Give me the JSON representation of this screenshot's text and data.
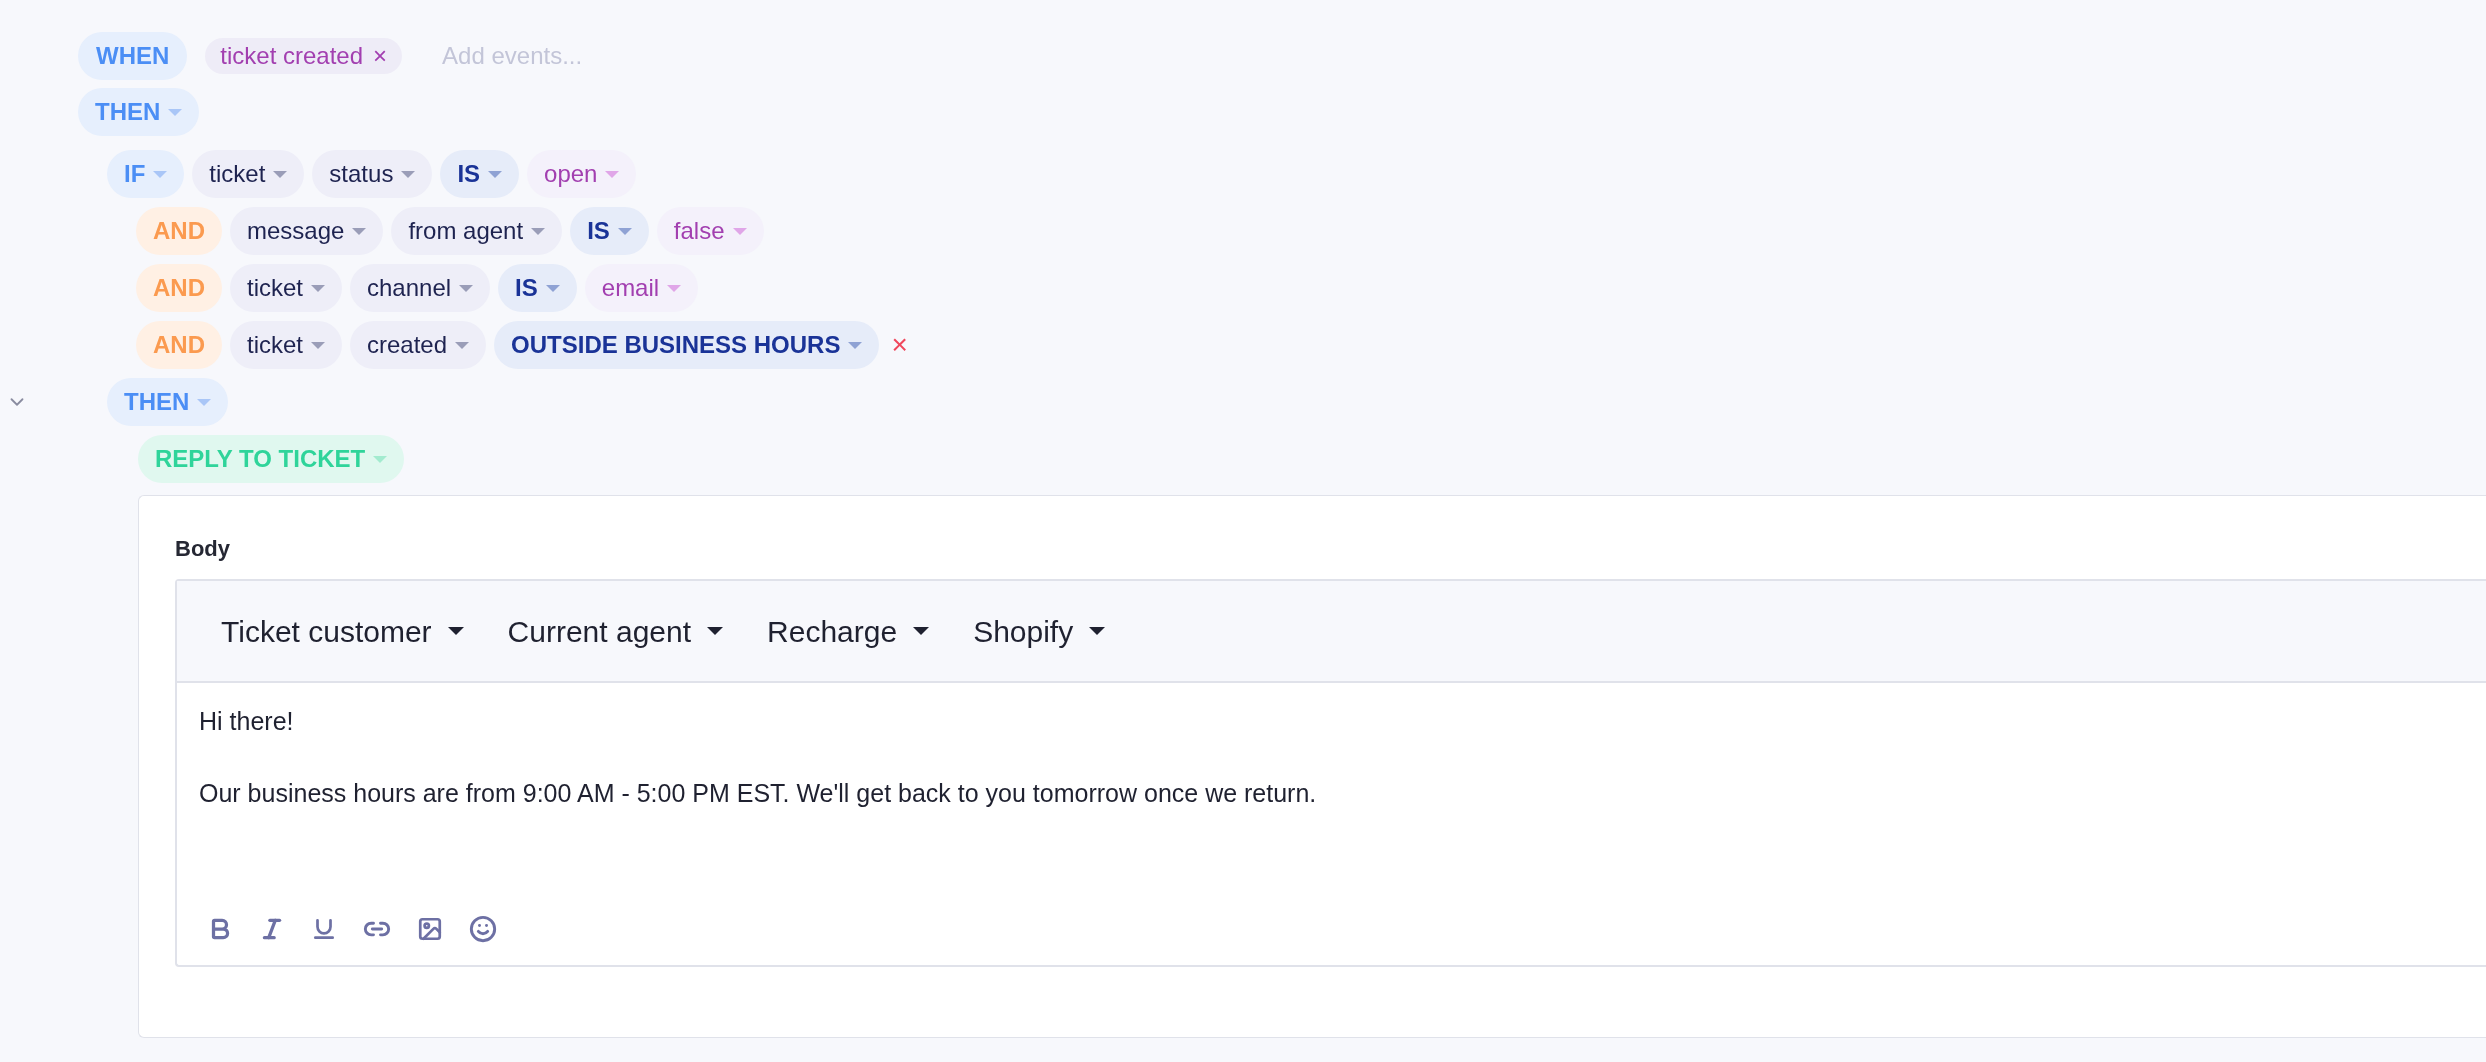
{
  "trigger": {
    "label": "WHEN",
    "events": [
      {
        "label": "ticket created",
        "remove": "×"
      }
    ],
    "placeholder": "Add events..."
  },
  "then": {
    "label": "THEN"
  },
  "conditions": [
    {
      "conjunction": {
        "text": "IF",
        "kind": "keyword"
      },
      "tokens": [
        {
          "text": "ticket",
          "kind": "field"
        },
        {
          "text": "status",
          "kind": "field"
        },
        {
          "text": "IS",
          "kind": "operator"
        },
        {
          "text": "open",
          "kind": "value"
        }
      ]
    },
    {
      "conjunction": {
        "text": "AND",
        "kind": "conjunction"
      },
      "tokens": [
        {
          "text": "message",
          "kind": "field"
        },
        {
          "text": "from agent",
          "kind": "field"
        },
        {
          "text": "IS",
          "kind": "operator"
        },
        {
          "text": "false",
          "kind": "value"
        }
      ]
    },
    {
      "conjunction": {
        "text": "AND",
        "kind": "conjunction"
      },
      "tokens": [
        {
          "text": "ticket",
          "kind": "field"
        },
        {
          "text": "channel",
          "kind": "field"
        },
        {
          "text": "IS",
          "kind": "operator"
        },
        {
          "text": "email",
          "kind": "value"
        }
      ]
    },
    {
      "conjunction": {
        "text": "AND",
        "kind": "conjunction"
      },
      "tokens": [
        {
          "text": "ticket",
          "kind": "field"
        },
        {
          "text": "created",
          "kind": "field"
        },
        {
          "text": "OUTSIDE BUSINESS HOURS",
          "kind": "operator"
        }
      ],
      "remove": "×"
    }
  ],
  "inner_then": {
    "label": "THEN",
    "expanded": true
  },
  "action": {
    "label": "REPLY TO TICKET",
    "body_label": "Body",
    "variables": [
      "Ticket customer",
      "Current agent",
      "Recharge",
      "Shopify"
    ],
    "paragraphs": [
      "Hi there!",
      "Our business hours are from 9:00 AM - 5:00 PM EST. We'll get back to you tomorrow once we return."
    ]
  }
}
